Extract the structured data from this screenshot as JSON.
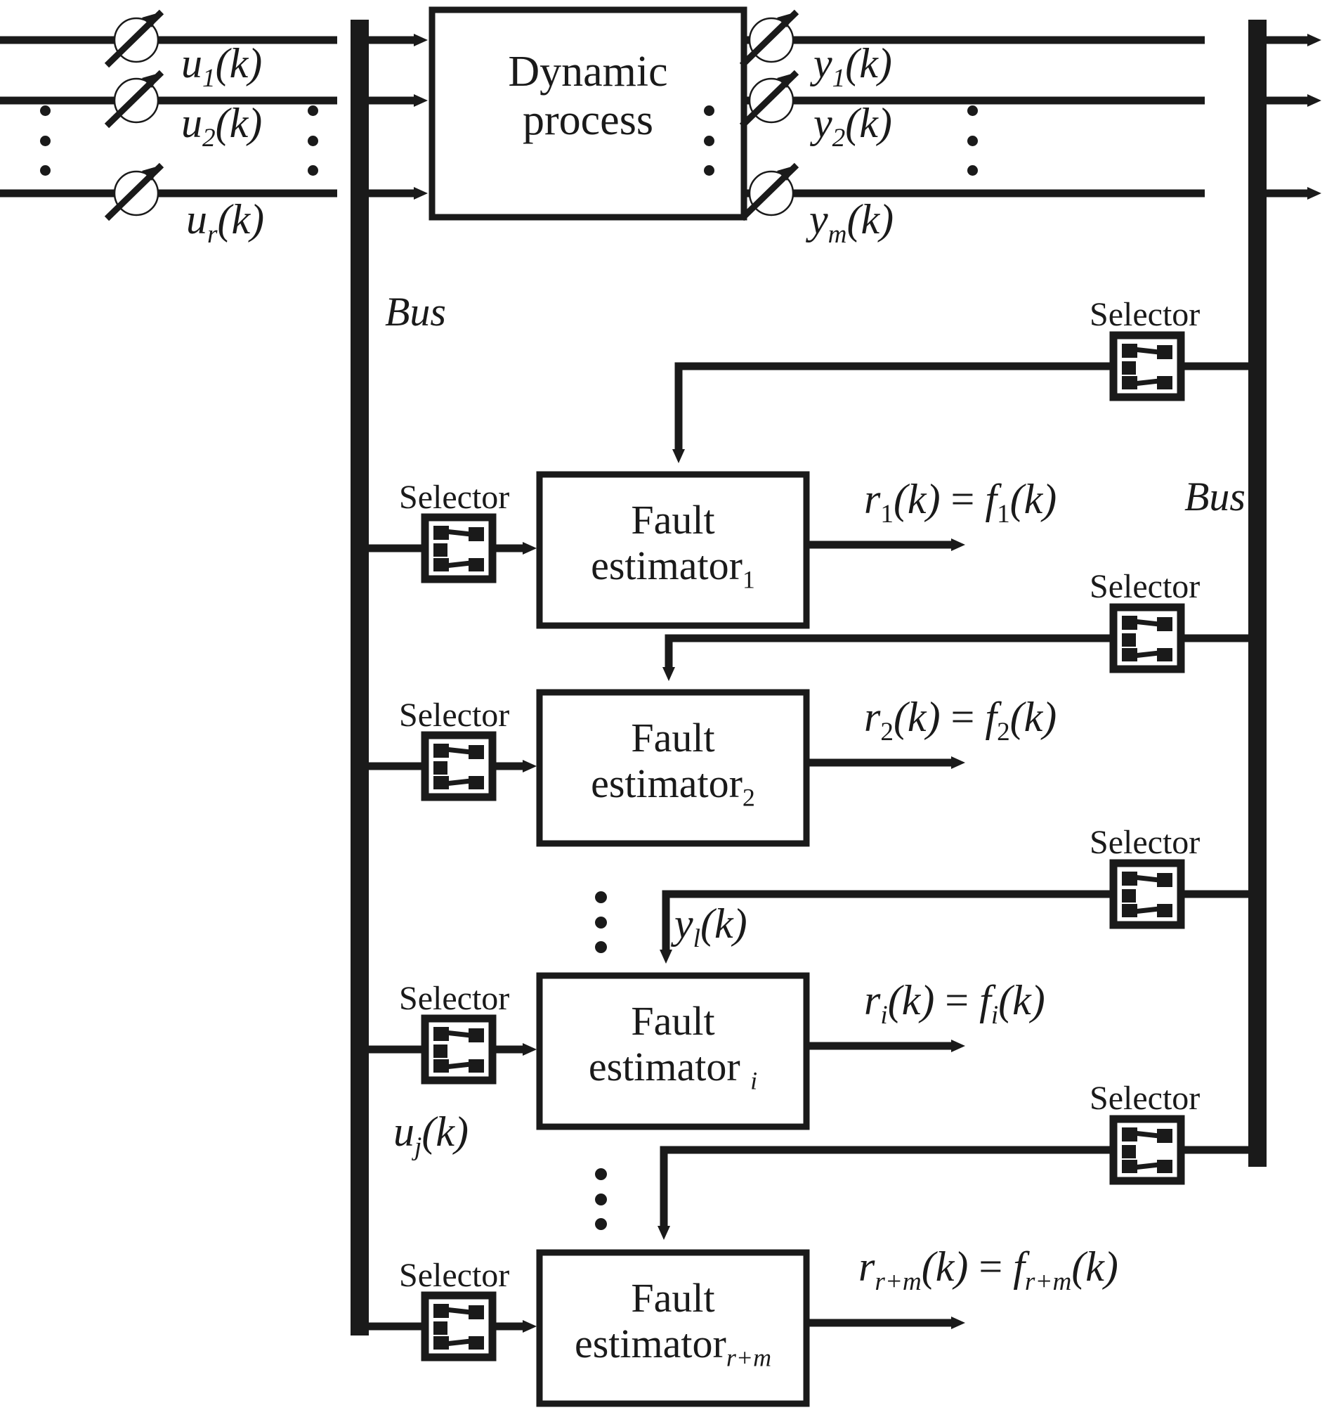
{
  "figure": {
    "kind": "block-diagram",
    "title_in_image": "",
    "stroke_color": "#1a1a1a",
    "background_color": "#ffffff"
  },
  "process": {
    "label_line1": "Dynamic",
    "label_line2": "process"
  },
  "bus": {
    "left_label": "Bus",
    "right_label": "Bus"
  },
  "inputs": {
    "signals": [
      {
        "base": "u",
        "sub": "1",
        "arg": "(k)"
      },
      {
        "base": "u",
        "sub": "2",
        "arg": "(k)"
      },
      {
        "base": "u",
        "sub": "r",
        "arg": "(k)"
      }
    ],
    "ellipsis": "⋮"
  },
  "outputs": {
    "signals": [
      {
        "base": "y",
        "sub": "1",
        "arg": "(k)"
      },
      {
        "base": "y",
        "sub": "2",
        "arg": "(k)"
      },
      {
        "base": "y",
        "sub": "m",
        "arg": "(k)"
      }
    ],
    "ellipsis": "⋮"
  },
  "selector_label": "Selector",
  "estimators": [
    {
      "id": "fe1",
      "line1": "Fault",
      "line2": "estimator",
      "subscript": "1",
      "subscript_italic": false,
      "input_selector_label": "Selector",
      "top_selector_label": "Selector",
      "residual": {
        "r_base": "r",
        "r_sub": "1",
        "eq": "=",
        "f_base": "f",
        "f_sub": "1",
        "arg": "(k)"
      }
    },
    {
      "id": "fe2",
      "line1": "Fault",
      "line2": "estimator",
      "subscript": "2",
      "subscript_italic": false,
      "input_selector_label": "Selector",
      "top_selector_label": "Selector",
      "residual": {
        "r_base": "r",
        "r_sub": "2",
        "eq": "=",
        "f_base": "f",
        "f_sub": "2",
        "arg": "(k)"
      }
    },
    {
      "id": "fei",
      "line1": "Fault",
      "line2": "estimator",
      "subscript": "i",
      "subscript_italic": true,
      "input_selector_label": "Selector",
      "top_selector_label": "Selector",
      "residual": {
        "r_base": "r",
        "r_sub": "i",
        "eq": "=",
        "f_base": "f",
        "f_sub": "i",
        "arg": "(k)"
      }
    },
    {
      "id": "ferm",
      "line1": "Fault",
      "line2": "estimator",
      "subscript": "r+m",
      "subscript_italic": true,
      "input_selector_label": "Selector",
      "top_selector_label": "Selector",
      "residual": {
        "r_base": "r",
        "r_sub": "r+m",
        "eq": "=",
        "f_base": "f",
        "f_sub": "r+m",
        "arg": "(k)"
      }
    }
  ],
  "annotations": {
    "measured_output": {
      "base": "y",
      "sub": "l",
      "arg": "(k)"
    },
    "measured_input": {
      "base": "u",
      "sub": "j",
      "arg": "(k)"
    },
    "vertical_ellipsis": "⋮"
  }
}
